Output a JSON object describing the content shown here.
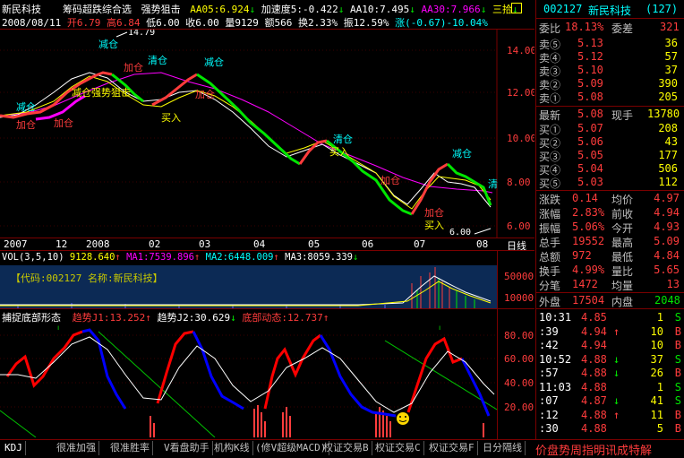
{
  "header": {
    "stock_name": "新民科技",
    "indicator_name": "筹码超跌综合选",
    "strength_label": "强势狙击",
    "aa05": "AA05:6.924",
    "aa05_arrow": "↓",
    "speed": "加速度5:-0.422",
    "speed_arrow": "↓",
    "aa10": "AA10:7.495",
    "aa10_arrow": "↓",
    "aa30": "AA30:7.966",
    "aa30_arrow": "↓",
    "sanshi": "三拾",
    "sanshi_arrow": "↓"
  },
  "info_line": {
    "date": "2008/08/11",
    "open": "开6.79",
    "high": "高6.84",
    "low": "低6.00",
    "close": "收6.00",
    "volume": "量9129",
    "amount": "额566",
    "turnover": "换2.33%",
    "amplitude": "振12.59%",
    "change": "涨(-0.67)-10.04%"
  },
  "main_chart": {
    "price_ticks": [
      "14.00",
      "12.00",
      "10.00",
      "8.00",
      "6.00"
    ],
    "high_marker": "14.79",
    "low_marker": "6.00",
    "annotations": [
      {
        "text": "减仓",
        "color": "#00ffff"
      },
      {
        "text": "加仓",
        "color": "#ff3c3c"
      },
      {
        "text": "加仓",
        "color": "#ff3c3c"
      },
      {
        "text": "减仓",
        "color": "#00ffff"
      },
      {
        "text": "减仓强势狙击",
        "color": "#ffff00"
      },
      {
        "text": "清仓",
        "color": "#00ffff"
      },
      {
        "text": "加仓",
        "color": "#ff3c3c"
      },
      {
        "text": "减仓",
        "color": "#00ffff"
      },
      {
        "text": "加仓",
        "color": "#ff3c3c"
      },
      {
        "text": "买入",
        "color": "#ffff00"
      },
      {
        "text": "清仓",
        "color": "#00ffff"
      },
      {
        "text": "买入",
        "color": "#ffff00"
      },
      {
        "text": "加仓",
        "color": "#ff3c3c"
      },
      {
        "text": "减仓",
        "color": "#00ffff"
      },
      {
        "text": "加仓",
        "color": "#ff3c3c"
      },
      {
        "text": "买入",
        "color": "#ffff00"
      },
      {
        "text": "清",
        "color": "#00ffff"
      }
    ]
  },
  "date_axis": {
    "labels": [
      "2007",
      "12",
      "2008",
      "02",
      "03",
      "04",
      "05",
      "06",
      "07",
      "08"
    ],
    "period": "日线"
  },
  "vol_panel": {
    "title": "VOL(3,5,10)",
    "vol": "9128.640",
    "vol_arrow": "↑",
    "ma1": "MA1:7539.896",
    "ma1_arrow": "↑",
    "ma2": "MA2:6448.009",
    "ma2_arrow": "↑",
    "ma3": "MA3:8059.339",
    "ma3_arrow": "↓",
    "code_label": "【代码:002127 名称:新民科技】",
    "ticks": [
      "50000",
      "10000"
    ]
  },
  "osc_panel": {
    "title": "捕捉底部形态",
    "j1": "趋势J1:13.252",
    "j1_arrow": "↑",
    "j2": "趋势J2:30.629",
    "j2_arrow": "↓",
    "bottom": "底部动态:12.737",
    "bottom_arrow": "↑",
    "ticks": [
      "80.00",
      "60.00",
      "40.00",
      "20.00"
    ]
  },
  "right_panel": {
    "code": "002127",
    "name": "新民科技",
    "count": "(127)",
    "wb_label": "委比",
    "wb_value": "18.13%",
    "wc_label": "委差",
    "wc_value": "321",
    "asks": [
      {
        "label": "卖⑤",
        "price": "5.13",
        "vol": "36"
      },
      {
        "label": "卖④",
        "price": "5.12",
        "vol": "57"
      },
      {
        "label": "卖③",
        "price": "5.10",
        "vol": "37"
      },
      {
        "label": "卖②",
        "price": "5.09",
        "vol": "390"
      },
      {
        "label": "卖①",
        "price": "5.08",
        "vol": "205"
      }
    ],
    "last_label": "最新",
    "last_value": "5.08",
    "now_label": "现手",
    "now_value": "13780",
    "bids": [
      {
        "label": "买①",
        "price": "5.07",
        "vol": "208"
      },
      {
        "label": "买②",
        "price": "5.06",
        "vol": "43"
      },
      {
        "label": "买③",
        "price": "5.05",
        "vol": "177"
      },
      {
        "label": "买④",
        "price": "5.04",
        "vol": "506"
      },
      {
        "label": "买⑤",
        "price": "5.03",
        "vol": "112"
      }
    ],
    "stats": [
      {
        "l1": "涨跌",
        "v1": "0.14",
        "l2": "均价",
        "v2": "4.97"
      },
      {
        "l1": "涨幅",
        "v1": "2.83%",
        "l2": "前收",
        "v2": "4.94"
      },
      {
        "l1": "振幅",
        "v1": "5.06%",
        "l2": "今开",
        "v2": "4.93"
      },
      {
        "l1": "总手",
        "v1": "19552",
        "l2": "最高",
        "v2": "5.09"
      },
      {
        "l1": "总额",
        "v1": "972",
        "l2": "最低",
        "v2": "4.84"
      },
      {
        "l1": "换手",
        "v1": "4.99%",
        "l2": "量比",
        "v2": "5.65"
      },
      {
        "l1": "分笔",
        "v1": "1472",
        "l2": "均量",
        "v2": "13"
      }
    ],
    "outer_label": "外盘",
    "outer_value": "17504",
    "inner_label": "内盘",
    "inner_value": "2048",
    "trades": [
      {
        "time": "10:31",
        "price": "4.85",
        "arrow": "",
        "vol": "1",
        "side": "S"
      },
      {
        "time": ":39",
        "price": "4.94",
        "arrow": "↑",
        "vol": "10",
        "side": "B"
      },
      {
        "time": ":42",
        "price": "4.94",
        "arrow": "",
        "vol": "10",
        "side": "B"
      },
      {
        "time": "10:52",
        "price": "4.88",
        "arrow": "↓",
        "vol": "37",
        "side": "S"
      },
      {
        "time": ":57",
        "price": "4.88",
        "arrow": "↓",
        "vol": "26",
        "side": "B"
      },
      {
        "time": "11:03",
        "price": "4.88",
        "arrow": "",
        "vol": "1",
        "side": "S"
      },
      {
        "time": ":07",
        "price": "4.87",
        "arrow": "↓",
        "vol": "41",
        "side": "S"
      },
      {
        "time": ":12",
        "price": "4.88",
        "arrow": "↑",
        "vol": "11",
        "side": "B"
      },
      {
        "time": ":30",
        "price": "4.88",
        "arrow": "",
        "vol": "5",
        "side": "B"
      }
    ]
  },
  "tabs": [
    "KDJ",
    "很准加强",
    "很准胜率",
    "V看盘助手",
    "机构K线",
    "(修V超级MACD)",
    "权证交易B",
    "权证交易C",
    "权证交易F",
    "日分隔线"
  ],
  "ticker_text": "价盘势周指明讯成特解"
}
